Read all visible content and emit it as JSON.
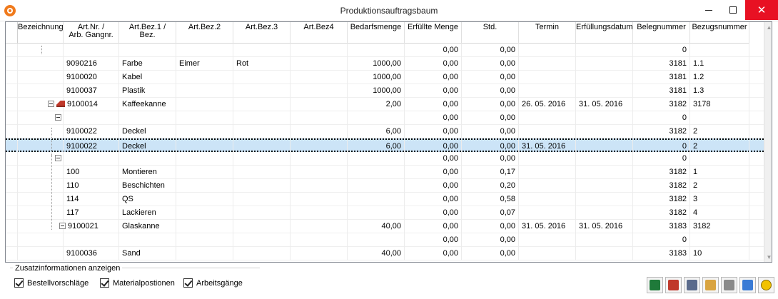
{
  "window": {
    "title": "Produktionsauftragsbaum"
  },
  "columns": [
    {
      "label": "Bezeichnung",
      "w": 64
    },
    {
      "label": "Art.Nr. /\nArb. Gangnr.",
      "w": 78
    },
    {
      "label": "Art.Bez.1 /\nBez.",
      "w": 80
    },
    {
      "label": "Art.Bez.2",
      "w": 80
    },
    {
      "label": "Art.Bez.3",
      "w": 80
    },
    {
      "label": "Art.Bez4",
      "w": 80
    },
    {
      "label": "Bedarfsmenge",
      "w": 80
    },
    {
      "label": "Erfüllte Menge",
      "w": 80
    },
    {
      "label": "Std.",
      "w": 80
    },
    {
      "label": "Termin",
      "w": 80
    },
    {
      "label": "Erfüllungsdatum",
      "w": 80
    },
    {
      "label": "Belegnummer",
      "w": 80
    },
    {
      "label": "Bezugsnummer",
      "w": 83
    }
  ],
  "rows": [
    {
      "art": "",
      "bez1": "",
      "bez2": "",
      "bez3": "",
      "bedarf": "",
      "erfuellt": "0,00",
      "std": "0,00",
      "termin": "",
      "erfdatum": "",
      "beleg": "0",
      "bezug": ""
    },
    {
      "art": "9090216",
      "bez1": "Farbe",
      "bez2": "Eimer",
      "bez3": "Rot",
      "bedarf": "1000,00",
      "erfuellt": "0,00",
      "std": "0,00",
      "termin": "",
      "erfdatum": "",
      "beleg": "3181",
      "bezug": "1.1"
    },
    {
      "art": "9100020",
      "bez1": "Kabel",
      "bez2": "",
      "bez3": "",
      "bedarf": "1000,00",
      "erfuellt": "0,00",
      "std": "0,00",
      "termin": "",
      "erfdatum": "",
      "beleg": "3181",
      "bezug": "1.2"
    },
    {
      "art": "9100037",
      "bez1": "Plastik",
      "bez2": "",
      "bez3": "",
      "bedarf": "1000,00",
      "erfuellt": "0,00",
      "std": "0,00",
      "termin": "",
      "erfdatum": "",
      "beleg": "3181",
      "bezug": "1.3"
    },
    {
      "art": "9100014",
      "bez1": "Kaffeekanne",
      "bez2": "",
      "bez3": "",
      "bedarf": "2,00",
      "erfuellt": "0,00",
      "std": "0,00",
      "termin": "26. 05. 2016",
      "erfdatum": "31. 05. 2016",
      "beleg": "3182",
      "bezug": "3178"
    },
    {
      "art": "",
      "bez1": "",
      "bez2": "",
      "bez3": "",
      "bedarf": "",
      "erfuellt": "0,00",
      "std": "0,00",
      "termin": "",
      "erfdatum": "",
      "beleg": "0",
      "bezug": ""
    },
    {
      "art": "9100022",
      "bez1": "Deckel",
      "bez2": "",
      "bez3": "",
      "bedarf": "6,00",
      "erfuellt": "0,00",
      "std": "0,00",
      "termin": "",
      "erfdatum": "",
      "beleg": "3182",
      "bezug": "2"
    },
    {
      "art": "9100022",
      "bez1": "Deckel",
      "bez2": "",
      "bez3": "",
      "bedarf": "6,00",
      "erfuellt": "0,00",
      "std": "0,00",
      "termin": "31. 05. 2016",
      "erfdatum": "",
      "beleg": "0",
      "bezug": "2"
    },
    {
      "art": "",
      "bez1": "",
      "bez2": "",
      "bez3": "",
      "bedarf": "",
      "erfuellt": "0,00",
      "std": "0,00",
      "termin": "",
      "erfdatum": "",
      "beleg": "0",
      "bezug": ""
    },
    {
      "art": "100",
      "bez1": "Montieren",
      "bez2": "",
      "bez3": "",
      "bedarf": "",
      "erfuellt": "0,00",
      "std": "0,17",
      "termin": "",
      "erfdatum": "",
      "beleg": "3182",
      "bezug": "1"
    },
    {
      "art": "110",
      "bez1": "Beschichten",
      "bez2": "",
      "bez3": "",
      "bedarf": "",
      "erfuellt": "0,00",
      "std": "0,20",
      "termin": "",
      "erfdatum": "",
      "beleg": "3182",
      "bezug": "2"
    },
    {
      "art": "114",
      "bez1": "QS",
      "bez2": "",
      "bez3": "",
      "bedarf": "",
      "erfuellt": "0,00",
      "std": "0,58",
      "termin": "",
      "erfdatum": "",
      "beleg": "3182",
      "bezug": "3"
    },
    {
      "art": "117",
      "bez1": "Lackieren",
      "bez2": "",
      "bez3": "",
      "bedarf": "",
      "erfuellt": "0,00",
      "std": "0,07",
      "termin": "",
      "erfdatum": "",
      "beleg": "3182",
      "bezug": "4"
    },
    {
      "art": "9100021",
      "bez1": "Glaskanne",
      "bez2": "",
      "bez3": "",
      "bedarf": "40,00",
      "erfuellt": "0,00",
      "std": "0,00",
      "termin": "31. 05. 2016",
      "erfdatum": "31. 05. 2016",
      "beleg": "3183",
      "bezug": "3182"
    },
    {
      "art": "",
      "bez1": "",
      "bez2": "",
      "bez3": "",
      "bedarf": "",
      "erfuellt": "0,00",
      "std": "0,00",
      "termin": "",
      "erfdatum": "",
      "beleg": "0",
      "bezug": ""
    },
    {
      "art": "9100036",
      "bez1": "Sand",
      "bez2": "",
      "bez3": "",
      "bedarf": "40,00",
      "erfuellt": "0,00",
      "std": "0,00",
      "termin": "",
      "erfdatum": "",
      "beleg": "3183",
      "bezug": "10"
    }
  ],
  "options": {
    "group_label": "Zusatzinformationen anzeigen",
    "checkboxes": [
      {
        "label": "Bestellvorschläge",
        "checked": true
      },
      {
        "label": "Materialpostionen",
        "checked": true
      },
      {
        "label": "Arbeitsgänge",
        "checked": true
      }
    ]
  },
  "toolbar": [
    {
      "icon": "excel-export-icon",
      "color": "#1f7a3a"
    },
    {
      "icon": "factory-icon",
      "color": "#c0392b"
    },
    {
      "icon": "building-icon",
      "color": "#5b6b8c"
    },
    {
      "icon": "document-edit-icon",
      "color": "#d9a441"
    },
    {
      "icon": "printer-icon",
      "color": "#8a8a8a"
    },
    {
      "icon": "users-icon",
      "color": "#3a7bd5"
    },
    {
      "icon": "info-icon",
      "color": "#f2c200"
    }
  ]
}
